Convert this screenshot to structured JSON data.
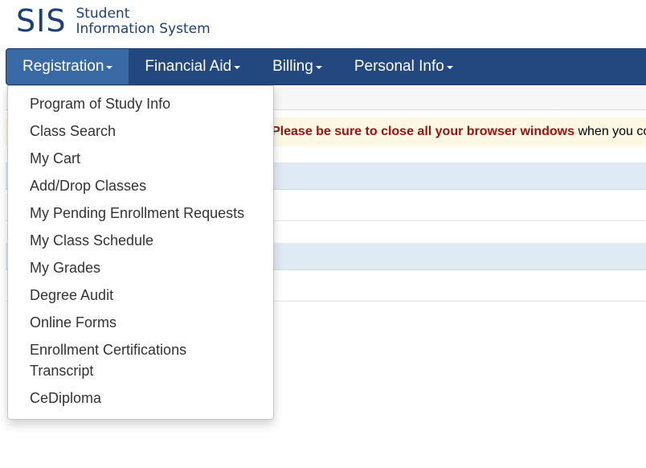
{
  "logo": {
    "mark": "SIS",
    "line1": "Student",
    "line2": "Information System"
  },
  "nav": {
    "items": [
      {
        "label": "Registration"
      },
      {
        "label": "Financial Aid"
      },
      {
        "label": "Billing"
      },
      {
        "label": "Personal Info"
      }
    ]
  },
  "notice": {
    "strong": "Please be sure to close all your browser windows",
    "rest": " when you co"
  },
  "dropdown": {
    "items": [
      {
        "label": "Program of Study Info"
      },
      {
        "label": "Class Search"
      },
      {
        "label": "My Cart"
      },
      {
        "label": "Add/Drop Classes"
      },
      {
        "label": "My Pending Enrollment Requests"
      },
      {
        "label": "My Class Schedule"
      },
      {
        "label": "My Grades"
      },
      {
        "label": "Degree Audit"
      },
      {
        "label": "Online Forms"
      },
      {
        "label": "Enrollment Certifications"
      },
      {
        "label": "Transcript"
      },
      {
        "label": "CeDiploma"
      }
    ]
  },
  "colors": {
    "navbar": "#23477f",
    "navbar_active": "#3a6aa6",
    "notice_bg": "#fcf8e3",
    "notice_strong": "#a01010",
    "row_blue": "#dfeaf5"
  }
}
